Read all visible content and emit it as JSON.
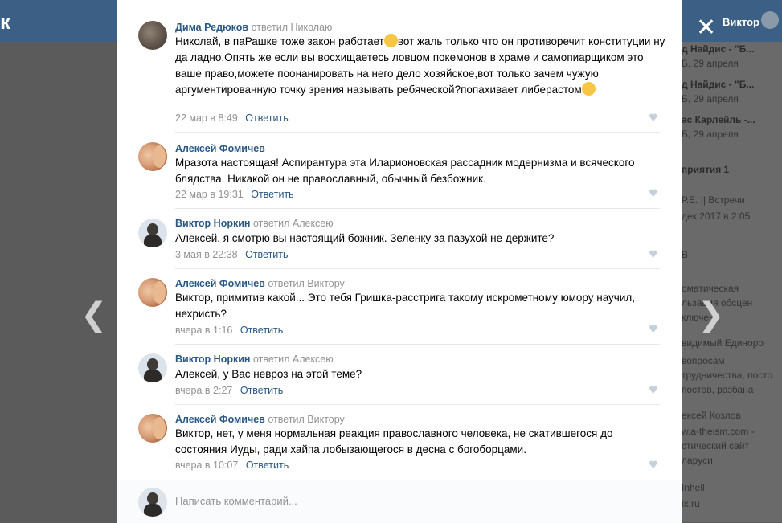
{
  "background": {
    "logo": "к",
    "user_name": "Виктор",
    "side_items": [
      {
        "text": "д Найдис - \"Б...",
        "bold": true
      },
      {
        "text": "Б, 29 апреля",
        "bold": false
      },
      {
        "text": "д Найдис - \"Б...",
        "bold": true
      },
      {
        "text": "Б, 29 апреля",
        "bold": false
      },
      {
        "text": "ас Карлейль -...",
        "bold": true
      },
      {
        "text": "Б, 29 апреля",
        "bold": false
      },
      {
        "text": "приятия  1",
        "bold": true
      },
      {
        "text": "Р.Е. || Встречи",
        "bold": false
      },
      {
        "text": "дек 2017 в 2:05",
        "bold": false
      },
      {
        "text": "В",
        "bold": false
      },
      {
        "text": "оматическая",
        "bold": false
      },
      {
        "text": "льзация обсцен",
        "bold": false
      },
      {
        "text": "ключена",
        "bold": false
      },
      {
        "text": "видимый Единоро",
        "bold": false
      },
      {
        "text": "вопросам",
        "bold": false
      },
      {
        "text": "трудничества, посто",
        "bold": false
      },
      {
        "text": "постов, разбана",
        "bold": false
      },
      {
        "text": "ексей Козлов",
        "bold": false
      },
      {
        "text": "w.a-theism.com -",
        "bold": false
      },
      {
        "text": "стический сайт",
        "bold": false
      },
      {
        "text": "ларуси",
        "bold": false
      },
      {
        "text": "Inhell",
        "bold": false
      },
      {
        "text": "ix.ru",
        "bold": false
      }
    ]
  },
  "overlay": {
    "close_glyph": "✕",
    "prev_glyph": "❮",
    "next_glyph": "❯"
  },
  "reply_label": "Ответить",
  "comments": [
    {
      "author": "Дима Редюков",
      "replied_to": "ответил Николаю",
      "avatar": "dima",
      "text_parts": [
        "Николай, в паРашке тоже закон работает",
        "вот жаль только что он противоречит конституции ну да ладно.Опять же если вы восхищаетесь ловцом покемонов в храме и самопиарщиком это ваше право,можете поонанировать на него дело хозяйское,вот только зачем чужую аргументированную точку зрения называть ребяческой?попахивает либерастом"
      ],
      "time": "22 мар в 8:49"
    },
    {
      "author": "Алексей Фомичев",
      "replied_to": "",
      "avatar": "aleksei",
      "text": "Мразота настоящая! Аспирантура эта Иларионовская рассадник модернизма и всяческого блядства. Никакой он не православный, обычный безбожник.",
      "time": "22 мар в 19:31"
    },
    {
      "author": "Виктор Норкин",
      "replied_to": "ответил Алексею",
      "avatar": "viktor",
      "text": "Алексей, я смотрю вы настоящий божник. Зеленку за пазухой не держите?",
      "time": "3 мая в 22:38"
    },
    {
      "author": "Алексей Фомичев",
      "replied_to": "ответил Виктору",
      "avatar": "aleksei",
      "text": "Виктор, примитив какой... Это тебя Гришка-расстрига такому искрометному юмору научил, нехристь?",
      "time": "вчера в 1:16"
    },
    {
      "author": "Виктор Норкин",
      "replied_to": "ответил Алексею",
      "avatar": "viktor",
      "text": "Алексей, у Вас невроз на этой теме?",
      "time": "вчера в 2:27"
    },
    {
      "author": "Алексей Фомичев",
      "replied_to": "ответил Виктору",
      "avatar": "aleksei",
      "text": "Виктор, нет, у меня нормальная реакция православного человека, не скатившегося до состояния Иуды, ради хайпа лобызающегося в десна с богоборцами.",
      "time": "вчера в 10:07"
    }
  ],
  "composer": {
    "placeholder": "Написать комментарий..."
  },
  "heart_glyph": "♥"
}
